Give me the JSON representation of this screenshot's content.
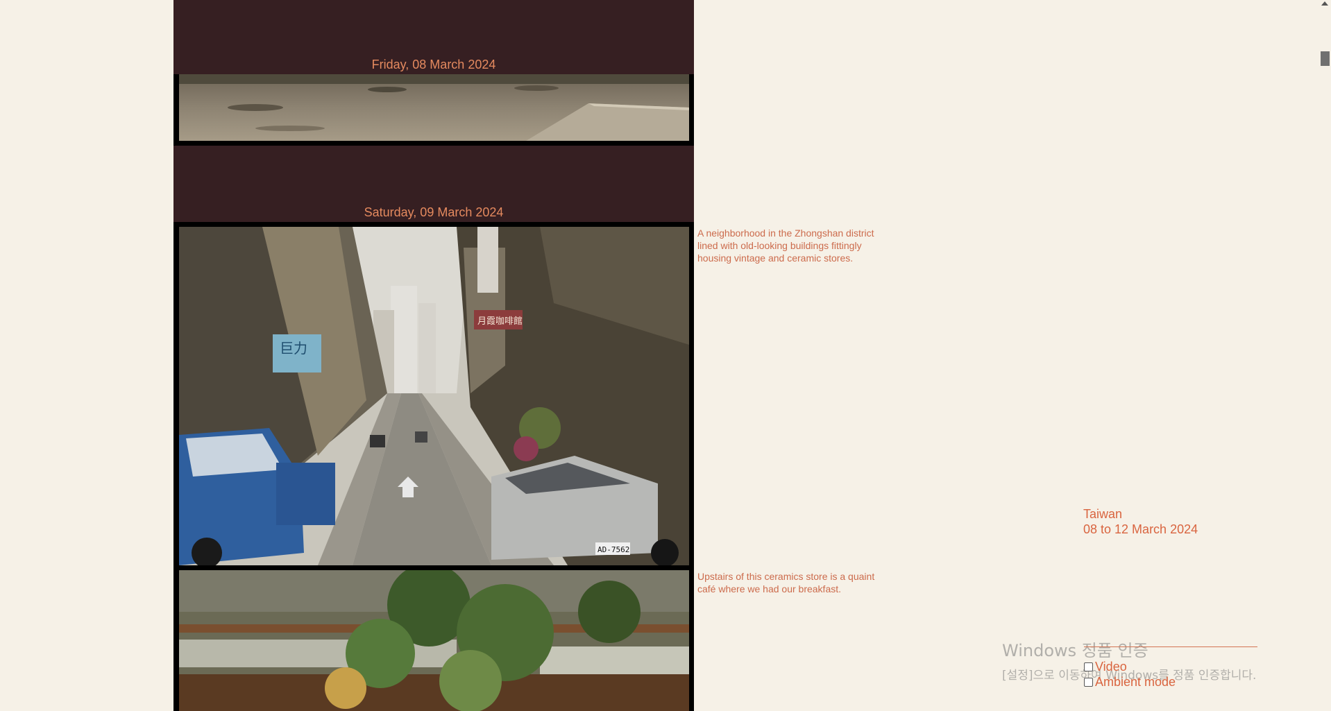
{
  "entries": [
    {
      "date": "Friday, 08 March 2024"
    },
    {
      "date": "Saturday, 09 March 2024"
    }
  ],
  "captions": [
    "A neighborhood in the Zhongshan district lined with old-looking buildings fittingly housing vintage and ceramic stores.",
    "Upstairs of this ceramics store is a quaint café where we had our breakfast."
  ],
  "trip": {
    "location": "Taiwan",
    "dates": "08 to 12 March 2024"
  },
  "controls": {
    "video_label": "Video",
    "ambient_label": "Ambient mode"
  },
  "watermark": {
    "title": "Windows 정품 인증",
    "subtitle": "[설정]으로 이동하여 Windows를 정품 인증합니다."
  },
  "sign_text": {
    "shop_sign": "巨力",
    "cafe_sign": "月霞咖啡館",
    "plate": "AD-7562"
  }
}
